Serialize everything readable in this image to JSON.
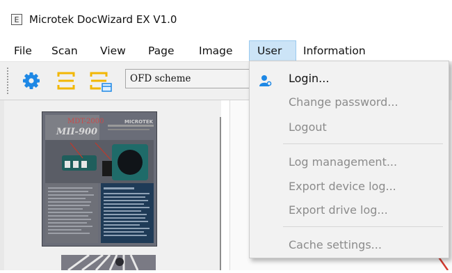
{
  "window": {
    "title": "Microtek DocWizard EX V1.0",
    "app_icon_letter": "E"
  },
  "menubar": {
    "items": [
      {
        "label": "File"
      },
      {
        "label": "Scan"
      },
      {
        "label": "View"
      },
      {
        "label": "Page"
      },
      {
        "label": "Image"
      },
      {
        "label": "User"
      },
      {
        "label": "Information"
      }
    ],
    "active": "User"
  },
  "toolbar": {
    "settings_icon": "gear-icon",
    "ofd_icon": "ofd-scheme-icon",
    "ofd_export_icon": "ofd-export-icon",
    "scheme_select_value": "OFD scheme"
  },
  "user_menu": {
    "items": [
      {
        "label": "Login...",
        "enabled": true,
        "icon": "user-key-icon"
      },
      {
        "label": "Change password...",
        "enabled": false
      },
      {
        "label": "Logout",
        "enabled": false
      },
      {
        "label": "Log management...",
        "enabled": false
      },
      {
        "label": "Export device log...",
        "enabled": false
      },
      {
        "label": "Export drive log...",
        "enabled": false
      },
      {
        "label": "Cache settings...",
        "enabled": false
      }
    ]
  },
  "thumbnail": {
    "brand": "MICROTEK",
    "model": "MII-900",
    "subtitle": "MDT-2000"
  },
  "colors": {
    "accent_blue": "#1e88e5",
    "icon_yellow": "#f2b705",
    "menu_highlight": "#cce4f7",
    "disabled_text": "#8b8b8b"
  }
}
